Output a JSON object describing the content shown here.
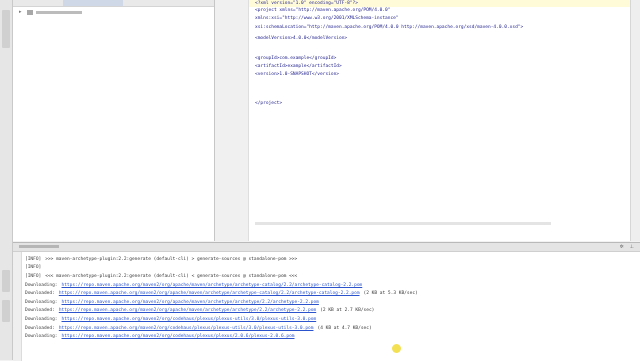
{
  "editor": {
    "code_lines": [
      "<?xml version=\"1.0\" encoding=\"UTF-8\"?>",
      "<project xmlns=\"http://maven.apache.org/POM/4.0.0\"",
      "         xmlns:xsi=\"http://www.w3.org/2001/XMLSchema-instance\"",
      "         xsi:schemaLocation=\"http://maven.apache.org/POM/4.0.0 http://maven.apache.org/xsd/maven-4.0.0.xsd\">",
      "    <modelVersion>4.0.0</modelVersion>",
      "",
      "    <groupId>com.example</groupId>",
      "    <artifactId>example</artifactId>",
      "    <version>1.0-SNAPSHOT</version>",
      "",
      "",
      "</project>"
    ]
  },
  "run_panel": {
    "lines": [
      {
        "tag": "[INFO]",
        "link": "",
        "suffix": ">>> maven-archetype-plugin:2.2:generate (default-cli) > generate-sources @ standalone-pom >>>"
      },
      {
        "tag": "[INFO]",
        "link": "",
        "suffix": ""
      },
      {
        "tag": "[INFO]",
        "link": "",
        "suffix": "<<< maven-archetype-plugin:2.2:generate (default-cli) < generate-sources @ standalone-pom <<<"
      },
      {
        "tag": "Downloading:",
        "link": "https://repo.maven.apache.org/maven2/org/apache/maven/archetype/archetype-catalog/2.2/archetype-catalog-2.2.pom",
        "suffix": ""
      },
      {
        "tag": "Downloaded:",
        "link": "https://repo.maven.apache.org/maven2/org/apache/maven/archetype/archetype-catalog/2.2/archetype-catalog-2.2.pom",
        "suffix": "(2 KB at 5.3 KB/sec)"
      },
      {
        "tag": "Downloading:",
        "link": "https://repo.maven.apache.org/maven2/org/apache/maven/archetype/archetype/2.2/archetype-2.2.pom",
        "suffix": ""
      },
      {
        "tag": "Downloaded:",
        "link": "https://repo.maven.apache.org/maven2/org/apache/maven/archetype/archetype/2.2/archetype-2.2.pom",
        "suffix": "(2 KB at 2.7 KB/sec)"
      },
      {
        "tag": "Downloading:",
        "link": "https://repo.maven.apache.org/maven2/org/codehaus/plexus/plexus-utils/3.0/plexus-utils-3.0.pom",
        "suffix": ""
      },
      {
        "tag": "Downloaded:",
        "link": "https://repo.maven.apache.org/maven2/org/codehaus/plexus/plexus-utils/3.0/plexus-utils-3.0.pom",
        "suffix": "(4 KB at 4.7 KB/sec)"
      },
      {
        "tag": "Downloading:",
        "link": "https://repo.maven.apache.org/maven2/org/codehaus/plexus/plexus/2.0.6/plexus-2.0.6.pom",
        "suffix": ""
      }
    ]
  }
}
